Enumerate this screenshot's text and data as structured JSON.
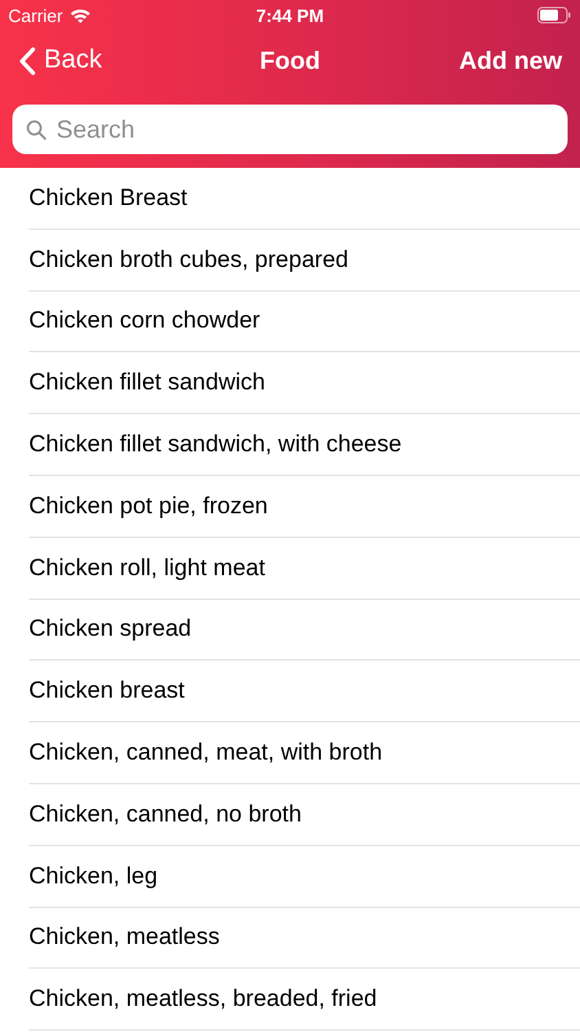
{
  "status_bar": {
    "carrier": "Carrier",
    "time": "7:44 PM"
  },
  "nav_bar": {
    "back": "Back",
    "title": "Food",
    "action": "Add new"
  },
  "search": {
    "placeholder": "Search"
  },
  "foods": [
    "Chicken Breast",
    "Chicken broth cubes, prepared",
    "Chicken corn chowder",
    "Chicken fillet sandwich",
    "Chicken fillet sandwich, with cheese",
    "Chicken pot pie, frozen",
    "Chicken roll, light meat",
    "Chicken spread",
    "Chicken breast",
    "Chicken, canned, meat, with broth",
    "Chicken, canned, no broth",
    "Chicken, leg",
    "Chicken, meatless",
    "Chicken, meatless, breaded, fried"
  ]
}
